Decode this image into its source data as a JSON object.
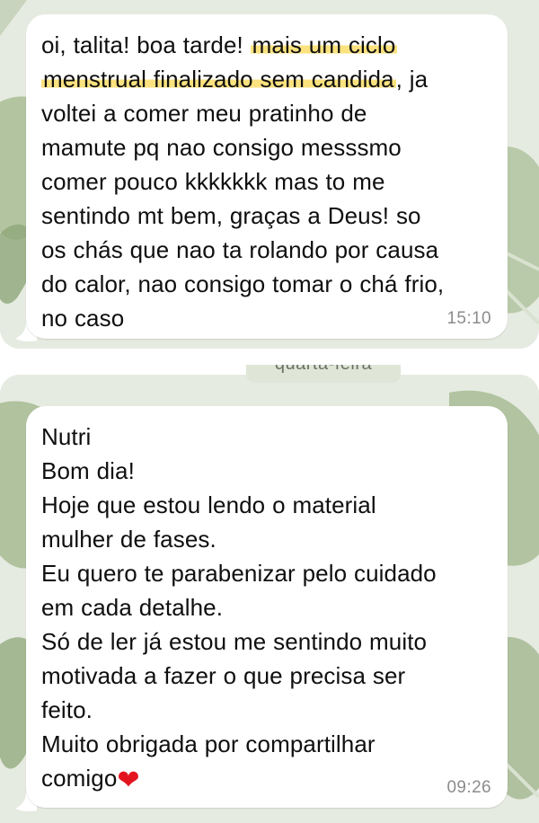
{
  "messages": [
    {
      "lines": [
        {
          "pre": "oi, talita! boa tarde! ",
          "highlight": "mais um ciclo"
        },
        {
          "pre": "",
          "highlight": "menstrual finalizado sem candida",
          "post": ", ja"
        },
        {
          "pre": "voltei a comer meu pratinho de"
        },
        {
          "pre": "mamute pq nao consigo messsmo"
        },
        {
          "pre": "comer pouco kkkkkkk mas to me"
        },
        {
          "pre": "sentindo mt bem, graças a Deus! so"
        },
        {
          "pre": "os chás que nao ta rolando por causa"
        },
        {
          "pre": "do calor, nao consigo tomar o chá frio,"
        },
        {
          "pre": "no caso"
        }
      ],
      "time": "15:10"
    },
    {
      "lines": [
        {
          "pre": "Nutri"
        },
        {
          "pre": "Bom dia!"
        },
        {
          "pre": "Hoje que estou lendo o material"
        },
        {
          "pre": "mulher de fases."
        },
        {
          "pre": "Eu quero te parabenizar pelo cuidado"
        },
        {
          "pre": "em cada detalhe."
        },
        {
          "pre": "Só de ler já estou me sentindo muito"
        },
        {
          "pre": "motivada a fazer o que precisa ser"
        },
        {
          "pre": "feito."
        },
        {
          "pre": "Muito obrigada por compartilhar"
        },
        {
          "pre": "comigo",
          "emoji": "❤"
        }
      ],
      "time": "09:26"
    }
  ],
  "date_separator": "quarta-feira",
  "colors": {
    "highlight": "#fbe27e",
    "bubble": "#ffffff",
    "wallpaper": "#e4e9df",
    "heart": "#e4141e"
  }
}
